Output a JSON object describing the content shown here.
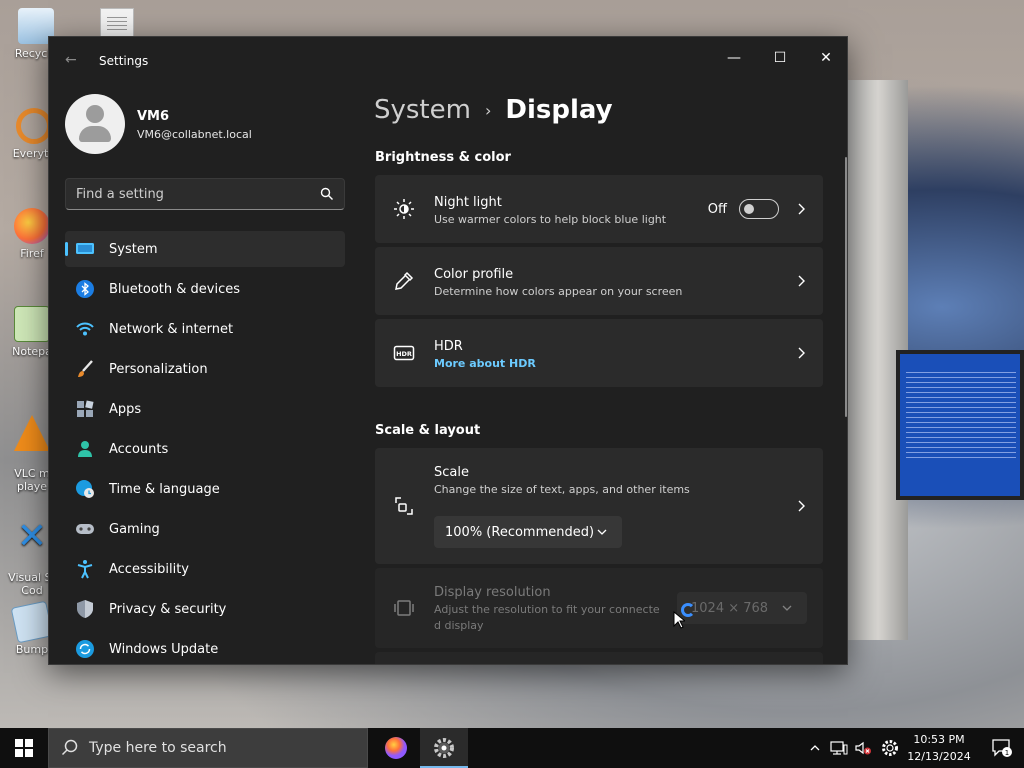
{
  "desktop": {
    "icons": [
      {
        "label": "Recycle",
        "color": "#6fa9d9"
      },
      {
        "label": "Everyth",
        "color": "#e88a2c"
      },
      {
        "label": "Firef",
        "color": "#ff7139"
      },
      {
        "label": "Notepa",
        "color": "#7fbf7f"
      },
      {
        "label": "VLC m\nplaye",
        "color": "#f08c1a"
      },
      {
        "label": "Visual St\nCod",
        "color": "#2f8fe5"
      },
      {
        "label": "Bump",
        "color": "#8fc4e8"
      }
    ]
  },
  "window": {
    "title": "Settings",
    "controls": {
      "minimize": "—",
      "maximize": "☐",
      "close": "✕"
    }
  },
  "profile": {
    "name": "VM6",
    "email": "VM6@collabnet.local"
  },
  "search": {
    "placeholder": "Find a setting",
    "value": ""
  },
  "nav": {
    "items": [
      {
        "label": "System",
        "icon": "monitor-icon",
        "active": true
      },
      {
        "label": "Bluetooth & devices",
        "icon": "bluetooth-icon"
      },
      {
        "label": "Network & internet",
        "icon": "wifi-icon"
      },
      {
        "label": "Personalization",
        "icon": "brush-icon"
      },
      {
        "label": "Apps",
        "icon": "apps-icon"
      },
      {
        "label": "Accounts",
        "icon": "person-icon"
      },
      {
        "label": "Time & language",
        "icon": "globe-clock-icon"
      },
      {
        "label": "Gaming",
        "icon": "gamepad-icon"
      },
      {
        "label": "Accessibility",
        "icon": "accessibility-icon"
      },
      {
        "label": "Privacy & security",
        "icon": "shield-icon"
      },
      {
        "label": "Windows Update",
        "icon": "update-icon"
      }
    ]
  },
  "breadcrumb": {
    "parent": "System",
    "separator": "›",
    "current": "Display"
  },
  "sections": {
    "brightness": "Brightness & color",
    "scale_layout": "Scale & layout"
  },
  "cards": {
    "night_light": {
      "title": "Night light",
      "subtitle": "Use warmer colors to help block blue light",
      "toggle_label": "Off",
      "toggle_on": false
    },
    "color_profile": {
      "title": "Color profile",
      "subtitle": "Determine how colors appear on your screen"
    },
    "hdr": {
      "title": "HDR",
      "link": "More about HDR"
    },
    "scale": {
      "title": "Scale",
      "subtitle": "Change the size of text, apps, and other items",
      "value": "100% (Recommended)"
    },
    "resolution": {
      "title": "Display resolution",
      "subtitle_line1": "Adjust the resolution to fit your connecte",
      "subtitle_line2": "d display",
      "value": "1024 × 768"
    }
  },
  "taskbar": {
    "search_placeholder": "Type here to search",
    "time": "10:53 PM",
    "date": "12/13/2024",
    "notification_count": "1"
  },
  "colors": {
    "accent": "#4cc2ff",
    "link": "#6ccbff",
    "window_bg": "#202020",
    "card_bg": "#2b2b2b"
  }
}
